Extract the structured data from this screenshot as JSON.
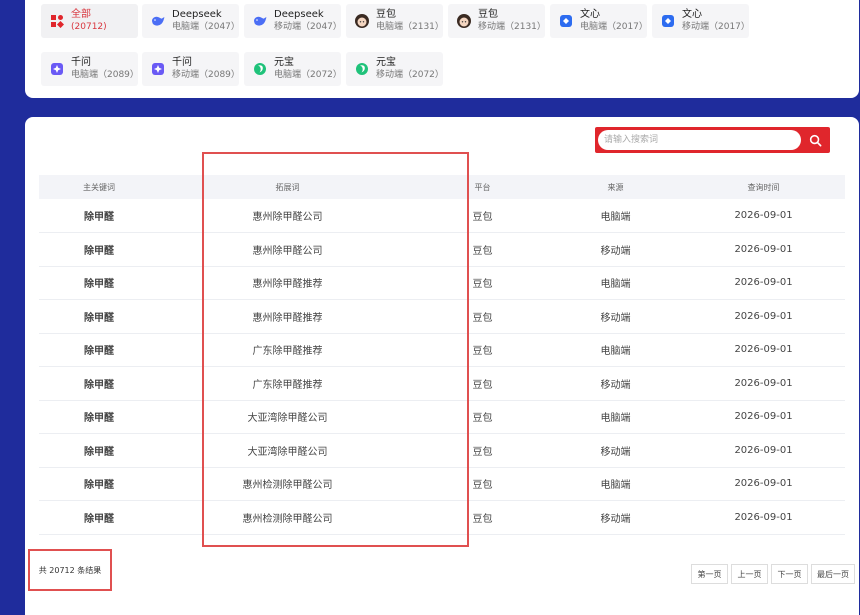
{
  "filters": [
    {
      "name": "全部",
      "sub": "(20712)",
      "icon": "all-grid-icon",
      "active": true
    },
    {
      "name": "Deepseek",
      "sub": "电脑端（2047）",
      "icon": "deepseek-whale-icon"
    },
    {
      "name": "Deepseek",
      "sub": "移动端（2047）",
      "icon": "deepseek-whale-icon"
    },
    {
      "name": "豆包",
      "sub": "电脑端（2131）",
      "icon": "doubao-avatar-icon"
    },
    {
      "name": "豆包",
      "sub": "移动端（2131）",
      "icon": "doubao-avatar-icon"
    },
    {
      "name": "文心",
      "sub": "电脑端（2017）",
      "icon": "wenxin-cube-icon"
    },
    {
      "name": "文心",
      "sub": "移动端（2017）",
      "icon": "wenxin-cube-icon"
    },
    {
      "name": "千问",
      "sub": "电脑端（2089）",
      "icon": "qianwen-star-icon"
    },
    {
      "name": "千问",
      "sub": "移动端（2089）",
      "icon": "qianwen-star-icon"
    },
    {
      "name": "元宝",
      "sub": "电脑端（2072）",
      "icon": "yuanbao-leaf-icon"
    },
    {
      "name": "元宝",
      "sub": "移动端（2072）",
      "icon": "yuanbao-leaf-icon"
    }
  ],
  "search": {
    "placeholder": "请输入搜索词",
    "value": ""
  },
  "table": {
    "headers": [
      "主关键词",
      "拓展词",
      "平台",
      "来源",
      "查询时间"
    ],
    "rows": [
      [
        "除甲醛",
        "惠州除甲醛公司",
        "豆包",
        "电脑端",
        "2026-09-01"
      ],
      [
        "除甲醛",
        "惠州除甲醛公司",
        "豆包",
        "移动端",
        "2026-09-01"
      ],
      [
        "除甲醛",
        "惠州除甲醛推荐",
        "豆包",
        "电脑端",
        "2026-09-01"
      ],
      [
        "除甲醛",
        "惠州除甲醛推荐",
        "豆包",
        "移动端",
        "2026-09-01"
      ],
      [
        "除甲醛",
        "广东除甲醛推荐",
        "豆包",
        "电脑端",
        "2026-09-01"
      ],
      [
        "除甲醛",
        "广东除甲醛推荐",
        "豆包",
        "移动端",
        "2026-09-01"
      ],
      [
        "除甲醛",
        "大亚湾除甲醛公司",
        "豆包",
        "电脑端",
        "2026-09-01"
      ],
      [
        "除甲醛",
        "大亚湾除甲醛公司",
        "豆包",
        "移动端",
        "2026-09-01"
      ],
      [
        "除甲醛",
        "惠州检测除甲醛公司",
        "豆包",
        "电脑端",
        "2026-09-01"
      ],
      [
        "除甲醛",
        "惠州检测除甲醛公司",
        "豆包",
        "移动端",
        "2026-09-01"
      ]
    ]
  },
  "total": "共 20712 条结果",
  "pager": {
    "first": "第一页",
    "prev": "上一页",
    "next": "下一页",
    "last": "最后一页"
  },
  "colors": {
    "accent": "#e0262c",
    "background": "#1f2c9c"
  }
}
